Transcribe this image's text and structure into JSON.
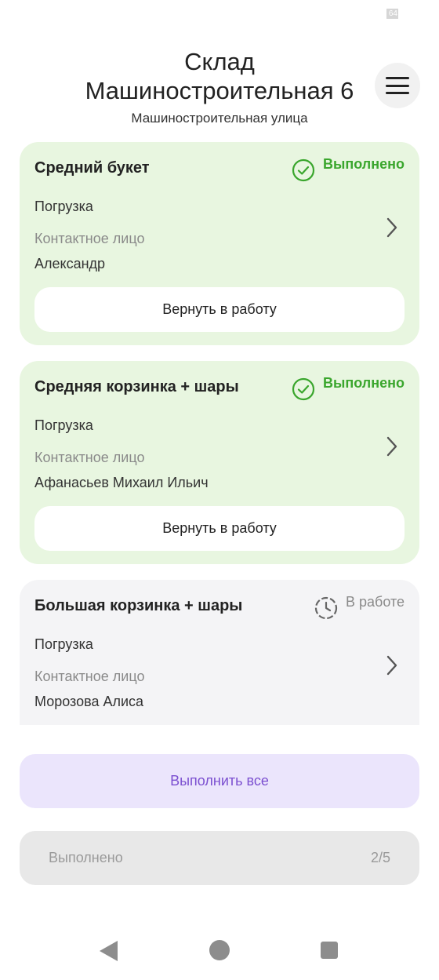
{
  "status_bar": {
    "battery_text": "64"
  },
  "header": {
    "title_line1": "Склад",
    "title_line2": "Машиностроительная 6",
    "subtitle": "Машиностроительная улица"
  },
  "menu": {
    "icon": "hamburger-icon"
  },
  "orders": [
    {
      "name": "Средний букет",
      "status": "Выполнено",
      "status_icon": "check-circle-icon",
      "operation": "Погрузка",
      "contact_label": "Контактное лицо",
      "contact_name": "Александр",
      "return_label": "Вернуть в работу"
    },
    {
      "name": "Средняя корзинка + шары",
      "status": "Выполнено",
      "status_icon": "check-circle-icon",
      "operation": "Погрузка",
      "contact_label": "Контактное лицо",
      "contact_name": "Афанасьев Михаил Ильич",
      "return_label": "Вернуть в работу"
    },
    {
      "name": "Большая корзинка + шары",
      "status": "В работе",
      "status_icon": "clock-icon",
      "operation": "Погрузка",
      "contact_label": "Контактное лицо",
      "contact_name": "Морозова Алиса"
    }
  ],
  "actions": {
    "complete_all": "Выполнить все",
    "done_label": "Выполнено",
    "done_count": "2/5"
  },
  "colors": {
    "done_bg": "#e8f6e0",
    "done_accent": "#3aa62d",
    "work_bg": "#f4f4f6",
    "primary_bg": "#ebe5fc",
    "primary_text": "#7b4fd0"
  }
}
